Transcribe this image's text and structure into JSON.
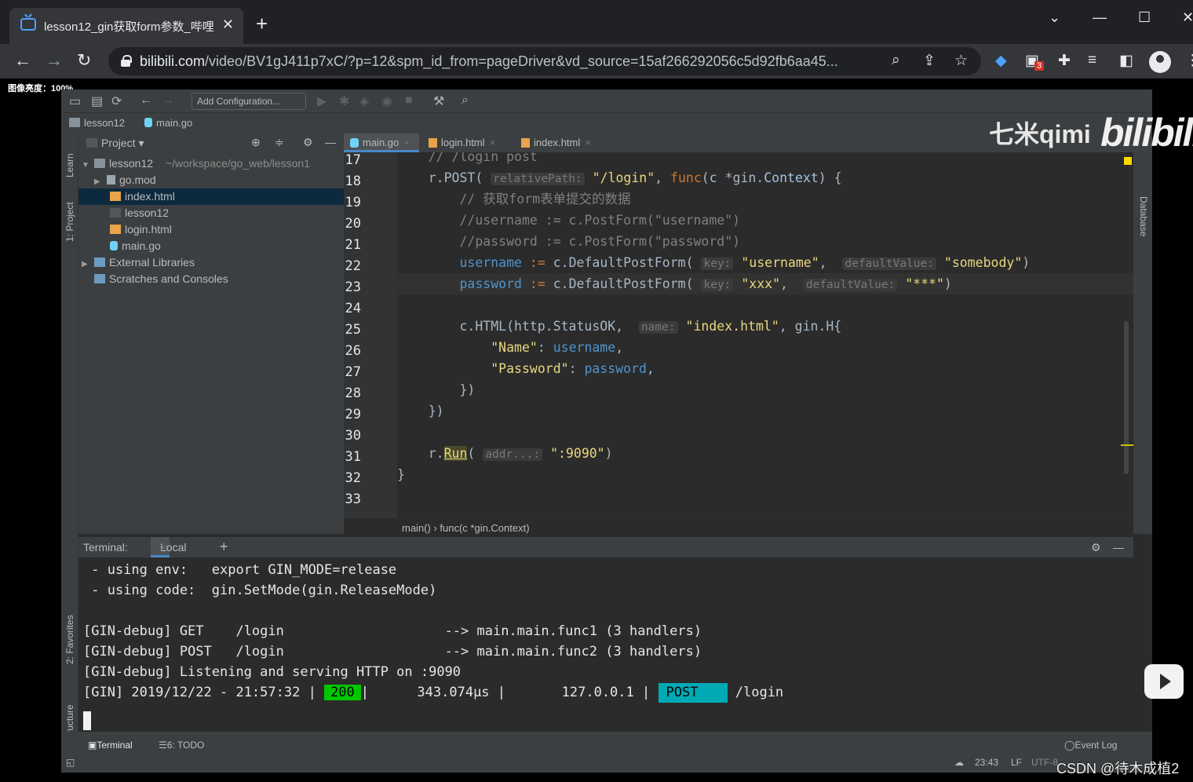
{
  "browser": {
    "tab_title": "lesson12_gin获取form参数_哔哩",
    "url_domain": "bilibili.com",
    "url_path": "/video/BV1gJ411p7xC/?p=12&spm_id_from=pageDriver&vd_source=15af266292056c5d92fb6aa45...",
    "extension_badge": "3"
  },
  "overlay": {
    "brightness": "图像亮度：100%",
    "watermark_channel": "七米qimi",
    "watermark_logo": "bilibili",
    "csdn": "CSDN @待木成植2"
  },
  "ide": {
    "toolbar": {
      "add_configuration": "Add Configuration..."
    },
    "nav": {
      "project": "lesson12",
      "file": "main.go"
    },
    "project_panel": {
      "title": "Project",
      "root": "lesson12",
      "root_path": "~/workspace/go_web/lesson1",
      "items": [
        {
          "label": "go.mod"
        },
        {
          "label": "index.html"
        },
        {
          "label": "lesson12"
        },
        {
          "label": "login.html"
        },
        {
          "label": "main.go"
        },
        {
          "label": "External Libraries"
        },
        {
          "label": "Scratches and Consoles"
        }
      ]
    },
    "side_tabs": {
      "learn": "Learn",
      "project": "1: Project",
      "favorites": "2: Favorites",
      "structure": "Z: Structure",
      "database": "Database"
    },
    "editor_tabs": [
      "main.go",
      "login.html",
      "index.html"
    ],
    "line_numbers": [
      "17",
      "18",
      "19",
      "20",
      "21",
      "22",
      "23",
      "24",
      "25",
      "26",
      "27",
      "28",
      "29",
      "30",
      "31",
      "32",
      "33"
    ],
    "breadcrumb": "main()  ›  func(c *gin.Context)",
    "terminal": {
      "label": "Terminal:",
      "tab": "Local",
      "lines": [
        " - using env:   export GIN_MODE=release",
        " - using code:  gin.SetMode(gin.ReleaseMode)",
        "",
        "[GIN-debug] GET    /login                    --> main.main.func1 (3 handlers)",
        "[GIN-debug] POST   /login                    --> main.main.func2 (3 handlers)",
        "[GIN-debug] Listening and serving HTTP on :9090"
      ],
      "gin_prefix": "[GIN] 2019/12/22 - 21:57:32 |",
      "status": "200",
      "latency": "|      343.074µs |       127.0.0.1 |",
      "method": "POST",
      "path": "/login"
    },
    "statusbar": {
      "terminal": "Terminal",
      "todo": "6: TODO",
      "event_log": "Event Log",
      "position": "23:43",
      "line_sep": "LF",
      "encoding": "UTF-8"
    }
  }
}
